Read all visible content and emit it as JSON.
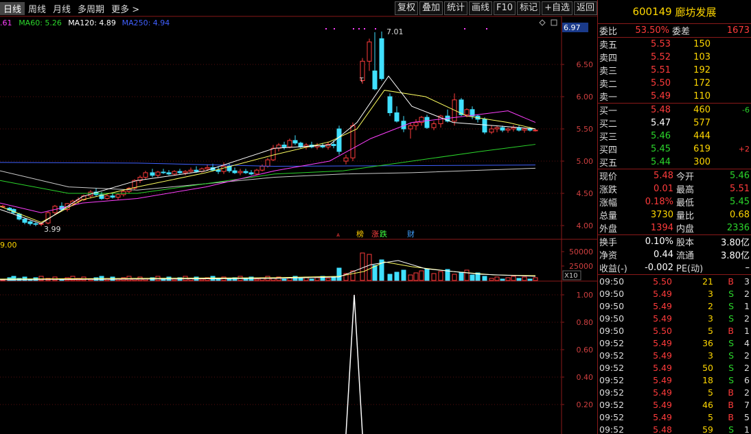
{
  "toolbar": {
    "left": [
      "日线",
      "周线",
      "月线",
      "多周期",
      "更多 >"
    ],
    "right": [
      "复权",
      "叠加",
      "统计",
      "画线",
      "F10",
      "标记",
      "+自选",
      "返回"
    ]
  },
  "ma_legend": [
    {
      "label": ".61",
      "color": "#ff40ff"
    },
    {
      "label": "MA60: 5.26",
      "color": "#2bd62b"
    },
    {
      "label": "MA120: 4.89",
      "color": "#ffffff"
    },
    {
      "label": "MA250: 4.94",
      "color": "#4060ff"
    }
  ],
  "price_axis": {
    "labels": [
      "6.50",
      "6.00",
      "5.50",
      "5.00",
      "4.50",
      "4.00"
    ],
    "current": "6.97"
  },
  "annotations": {
    "high": "7.01",
    "low": "3.99",
    "t_mark": "T"
  },
  "event_marks": [
    {
      "label": "榜",
      "color": "#ffcc00"
    },
    {
      "label": "涨",
      "color": "#ff4040"
    },
    {
      "label": "跌",
      "color": "#40ff40"
    },
    {
      "label": "财",
      "color": "#40a0ff"
    }
  ],
  "volume": {
    "top_label": "9.00",
    "axis": [
      "50000",
      "25000"
    ],
    "unit": "X10"
  },
  "indicator_axis": [
    "1.00",
    "0.80",
    "0.60",
    "0.40",
    "0.20"
  ],
  "stock": {
    "code": "600149",
    "name": "廊坊发展"
  },
  "weibi": {
    "label": "委比",
    "value": "53.50%",
    "label2": "委差",
    "value2": "1673"
  },
  "asks": [
    {
      "label": "卖五",
      "price": "5.53",
      "qty": "150",
      "delta": ""
    },
    {
      "label": "卖四",
      "price": "5.52",
      "qty": "103",
      "delta": ""
    },
    {
      "label": "卖三",
      "price": "5.51",
      "qty": "192",
      "delta": ""
    },
    {
      "label": "卖二",
      "price": "5.50",
      "qty": "172",
      "delta": ""
    },
    {
      "label": "卖一",
      "price": "5.49",
      "qty": "110",
      "delta": ""
    }
  ],
  "bids": [
    {
      "label": "买一",
      "price": "5.48",
      "qty": "460",
      "delta": "-6",
      "pc": "red",
      "dc": "green"
    },
    {
      "label": "买二",
      "price": "5.47",
      "qty": "577",
      "delta": "",
      "pc": "white",
      "dc": ""
    },
    {
      "label": "买三",
      "price": "5.46",
      "qty": "444",
      "delta": "",
      "pc": "green",
      "dc": ""
    },
    {
      "label": "买四",
      "price": "5.45",
      "qty": "619",
      "delta": "+2",
      "pc": "green",
      "dc": "red"
    },
    {
      "label": "买五",
      "price": "5.44",
      "qty": "300",
      "delta": "",
      "pc": "green",
      "dc": ""
    }
  ],
  "quote": [
    {
      "l": "现价",
      "v": "5.48",
      "vc": "red",
      "l2": "今开",
      "v2": "5.46",
      "v2c": "green"
    },
    {
      "l": "涨跌",
      "v": "0.01",
      "vc": "red",
      "l2": "最高",
      "v2": "5.51",
      "v2c": "red"
    },
    {
      "l": "涨幅",
      "v": "0.18%",
      "vc": "red",
      "l2": "最低",
      "v2": "5.45",
      "v2c": "green"
    },
    {
      "l": "总量",
      "v": "3730",
      "vc": "yellow",
      "l2": "量比",
      "v2": "0.68",
      "v2c": "yellow"
    },
    {
      "l": "外盘",
      "v": "1394",
      "vc": "red",
      "l2": "内盘",
      "v2": "2336",
      "v2c": "green"
    }
  ],
  "fundamentals": [
    {
      "l": "换手",
      "v": "0.10%",
      "l2": "股本",
      "v2": "3.80亿"
    },
    {
      "l": "净资",
      "v": "0.44",
      "l2": "流通",
      "v2": "3.80亿"
    },
    {
      "l": "收益(-)",
      "v": "-0.002",
      "l2": "PE(动)",
      "v2": "–"
    }
  ],
  "ticks": [
    {
      "t": "09:50",
      "p": "5.50",
      "n": "21",
      "s": "B",
      "c": "3"
    },
    {
      "t": "09:50",
      "p": "5.49",
      "n": "3",
      "s": "S",
      "c": "2"
    },
    {
      "t": "09:50",
      "p": "5.49",
      "n": "2",
      "s": "S",
      "c": "1"
    },
    {
      "t": "09:50",
      "p": "5.49",
      "n": "3",
      "s": "S",
      "c": "2"
    },
    {
      "t": "09:50",
      "p": "5.50",
      "n": "5",
      "s": "B",
      "c": "1"
    },
    {
      "t": "09:52",
      "p": "5.49",
      "n": "36",
      "s": "S",
      "c": "4"
    },
    {
      "t": "09:52",
      "p": "5.49",
      "n": "3",
      "s": "S",
      "c": "2"
    },
    {
      "t": "09:52",
      "p": "5.49",
      "n": "50",
      "s": "S",
      "c": "2"
    },
    {
      "t": "09:52",
      "p": "5.49",
      "n": "18",
      "s": "S",
      "c": "6"
    },
    {
      "t": "09:52",
      "p": "5.49",
      "n": "5",
      "s": "B",
      "c": "2"
    },
    {
      "t": "09:52",
      "p": "5.49",
      "n": "46",
      "s": "B",
      "c": "7"
    },
    {
      "t": "09:52",
      "p": "5.49",
      "n": "5",
      "s": "B",
      "c": "5"
    },
    {
      "t": "09:52",
      "p": "5.48",
      "n": "59",
      "s": "S",
      "c": "1"
    }
  ]
}
